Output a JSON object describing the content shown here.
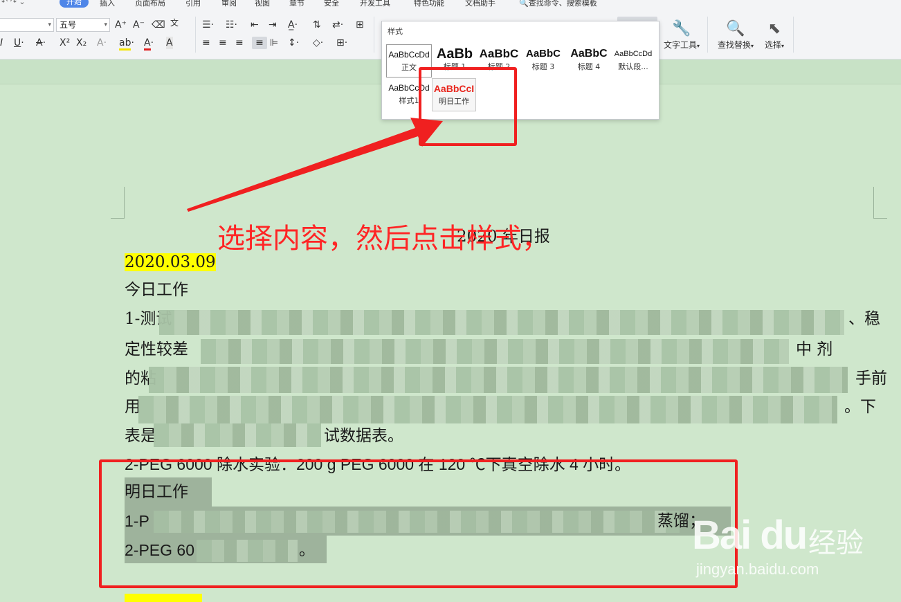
{
  "ribbon": {
    "tabs": [
      "开始",
      "插入",
      "页面布局",
      "引用",
      "审阅",
      "视图",
      "章节",
      "安全",
      "开发工具",
      "特色功能",
      "文档助手"
    ],
    "active_tab": "开始",
    "search_placeholder": "查找命令、搜索模板",
    "font_size": "五号",
    "buttons": {
      "text_tool": "文字工具",
      "find_replace": "查找替换",
      "select": "选择"
    }
  },
  "style_panel": {
    "title": "样式",
    "items": [
      {
        "preview": "AaBbCcDd",
        "name": "正文"
      },
      {
        "preview": "AaBb",
        "name": "标题 1"
      },
      {
        "preview": "AaBbC",
        "name": "标题 2"
      },
      {
        "preview": "AaBbC",
        "name": "标题 3"
      },
      {
        "preview": "AaBbC",
        "name": "标题 4"
      },
      {
        "preview": "AaBbCcDd",
        "name": "默认段..."
      },
      {
        "preview": "AaBbCcDd",
        "name": "样式1"
      },
      {
        "preview": "AaBbCcI",
        "name": "明日工作"
      }
    ]
  },
  "document": {
    "title": "2020 年日报",
    "date1": "2020.03.09",
    "today_heading": "今日工作",
    "p1_start": "1-测试",
    "p1_end": "、稳",
    "p2_start": "定性较差",
    "p2_end": "中  剂",
    "p3_start": "的粘",
    "p3_end": "手前",
    "p4_start": "用",
    "p4_end": "。下",
    "p5_start": "表是",
    "p5_end": "试数据表。",
    "line2": "2-PEG 6000 除水实验：200 g PEG 6000 在 120 ℃下真空除水 4 小时。",
    "tomorrow_heading": "明日工作",
    "t1_start": "1-P",
    "t1_end": "蒸馏；",
    "t2_start": "2-PEG 60",
    "t2_end": "。"
  },
  "annotation": {
    "text": "选择内容，然后点击样式，",
    "color": "#ff2525"
  },
  "watermark": {
    "logo": "Bai du",
    "cn": "经验",
    "url": "jingyan.baidu.com"
  }
}
